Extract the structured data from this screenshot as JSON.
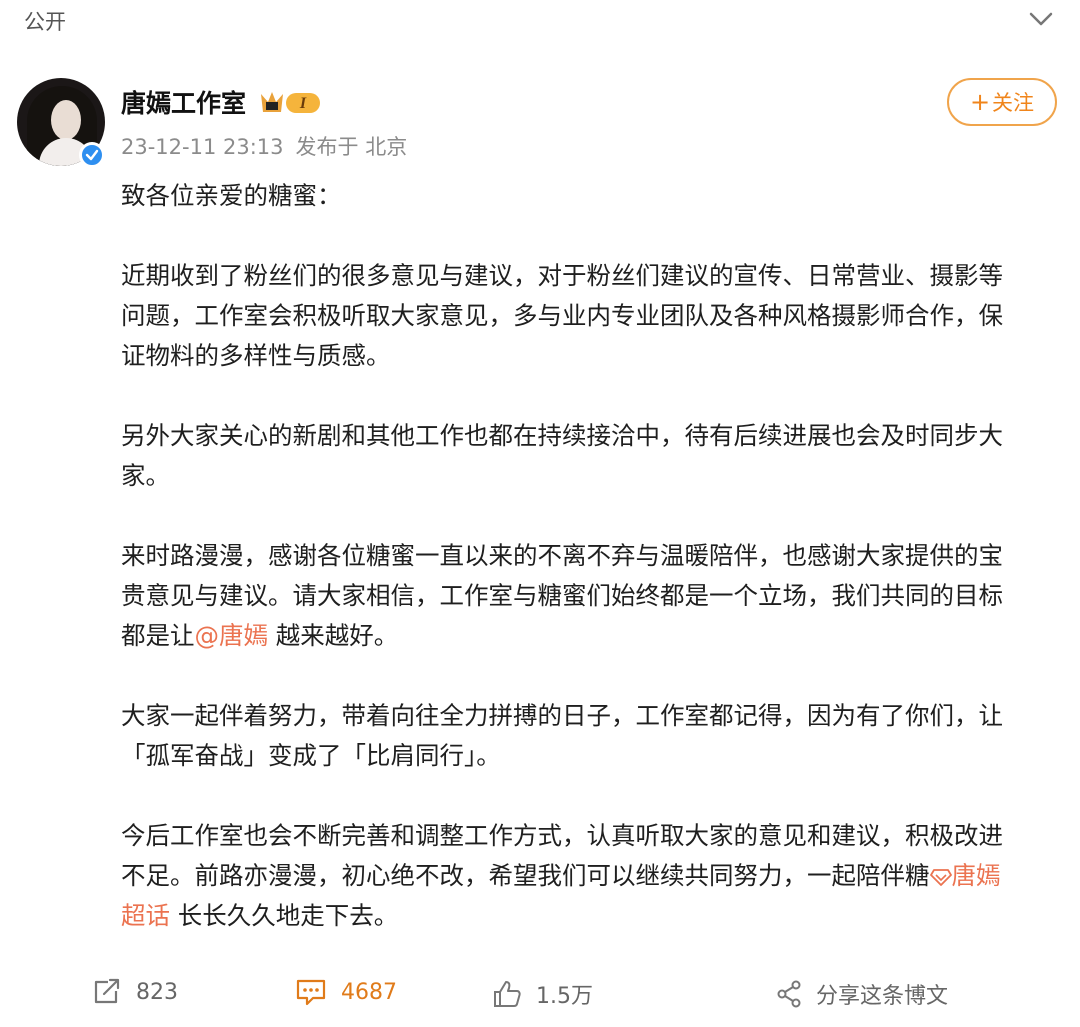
{
  "header": {
    "visibility": "公开"
  },
  "post": {
    "author": "唐嫣工作室",
    "vip_badge": "I",
    "timestamp": "23-12-11 23:13",
    "posted_from": "发布于 北京",
    "follow_label": "关注",
    "lines": [
      "致各位亲爱的糖蜜：",
      "",
      "近期收到了粉丝们的很多意见与建议，对于粉丝们建议的宣传、日常营业、摄影等",
      "问题，工作室会积极听取大家意见，多与业内专业团队及各种风格摄影师合作，保",
      "证物料的多样性与质感。",
      "",
      "另外大家关心的新剧和其他工作也都在持续接洽中，待有后续进展也会及时同步大",
      "家。",
      "",
      "来时路漫漫，感谢各位糖蜜一直以来的不离不弃与温暖陪伴，也感谢大家提供的宝",
      "贵意见与建议。请大家相信，工作室与糖蜜们始终都是一个立场，我们共同的目标",
      "",
      "",
      "大家一起伴着努力，带着向往全力拼搏的日子，工作室都记得，因为有了你们，让",
      "「孤军奋战」变成了「比肩同行」。",
      "",
      "今后工作室也会不断完善和调整工作方式，认真听取大家的意见和建议，积极改进"
    ],
    "mention_line": {
      "before": "都是让",
      "mention": "@唐嫣",
      "after": " 越来越好。"
    },
    "topic_line1": {
      "before": "不足。前路亦漫漫，初心绝不改，希望我们可以继续共同努力，一起陪伴糖",
      "topic": "唐嫣"
    },
    "topic_line2": {
      "topic": "超话",
      "after": " 长长久久地走下去。"
    }
  },
  "actions": {
    "repost_count": "823",
    "comment_count": "4687",
    "like_count": "1.5万",
    "share_label": "分享这条博文"
  },
  "colors": {
    "accent": "#eb7350",
    "follow": "#f0a44b",
    "verified": "#2e8ff0",
    "muted": "#8b8b8b"
  }
}
